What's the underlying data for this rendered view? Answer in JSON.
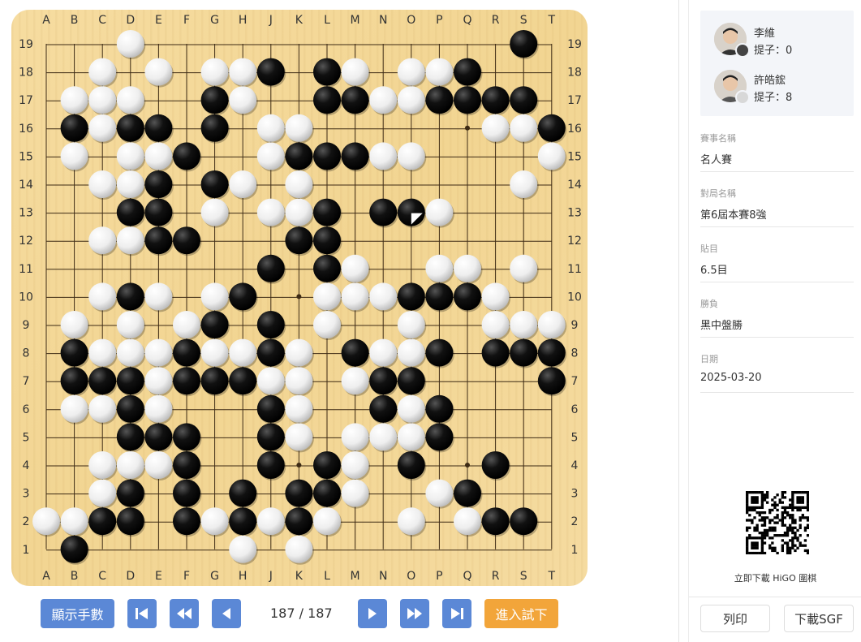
{
  "board": {
    "size": 19,
    "col_labels": [
      "A",
      "B",
      "C",
      "D",
      "E",
      "F",
      "G",
      "H",
      "J",
      "K",
      "L",
      "M",
      "N",
      "O",
      "P",
      "Q",
      "R",
      "S",
      "T"
    ],
    "row_labels": [
      "19",
      "18",
      "17",
      "16",
      "15",
      "14",
      "13",
      "12",
      "11",
      "10",
      "9",
      "8",
      "7",
      "6",
      "5",
      "4",
      "3",
      "2",
      "1"
    ],
    "rows": [
      "...W.............B.",
      "..W.W.WWB.BW.WWB...",
      ".WWW..BW..BBWWBBBB.",
      ".BWBB.B.WW......WWB",
      ".W.WWB..WBBBWW....W",
      "..WWB.BW.W.......W.",
      "...BB.W.WWB.BBW....",
      "..WWBB...BB........",
      "........B.BW..WW.W.",
      "..WBW.WB..WWWBBBW..",
      ".W.W.WB.B.W..W..WWW",
      ".BWWWBWWBW.BWWB.BBBW",
      ".BBBWBBBWW.WBB....BB",
      ".WWBW...BW..BWB....",
      "...BBB..BW.WWWB....",
      "..WWWB..B.BW.B..B..",
      "..WB.B.B.BBW..WB...",
      "WWBB.BWBWBW..W.WBB.",
      ".B.....W.W........."
    ],
    "last_move": "O13"
  },
  "controls": {
    "show_moves_label": "顯示手數",
    "move_counter": "187 / 187",
    "try_label": "進入試下"
  },
  "players": [
    {
      "name": "李維",
      "captures": "提子：0",
      "color": "black"
    },
    {
      "name": "許皓鋐",
      "captures": "提子：8",
      "color": "white"
    }
  ],
  "game_info": [
    {
      "label": "賽事名稱",
      "value": "名人賽"
    },
    {
      "label": "對局名稱",
      "value": "第6屆本賽8強"
    },
    {
      "label": "貼目",
      "value": "6.5目"
    },
    {
      "label": "勝負",
      "value": "黑中盤勝"
    },
    {
      "label": "日期",
      "value": "2025-03-20"
    }
  ],
  "qr_caption": "立即下載 HiGO 圍棋",
  "sidebar_buttons": {
    "print": "列印",
    "download": "下載SGF"
  },
  "colors": {
    "accent_blue": "#5b88d6",
    "accent_orange": "#f2a53a",
    "board": "#f3d79a"
  },
  "icons": [
    "first-move-icon",
    "back-ten-icon",
    "back-one-icon",
    "forward-one-icon",
    "forward-ten-icon",
    "last-move-icon"
  ]
}
